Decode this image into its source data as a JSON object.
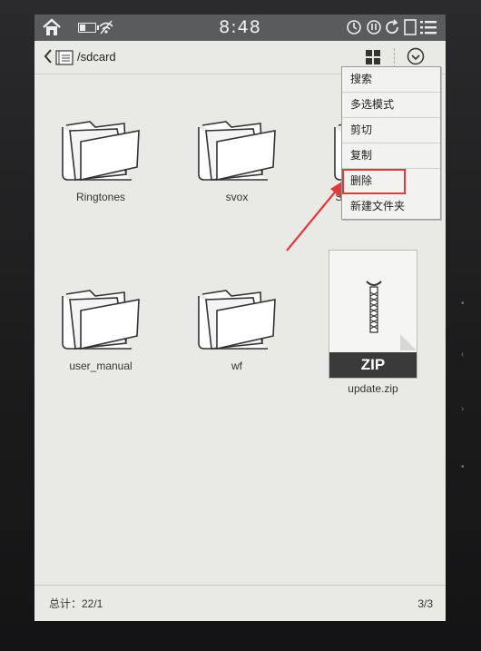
{
  "status_bar": {
    "time": "8:48",
    "battery_level": 0.3,
    "icons": [
      "home-icon",
      "battery-icon",
      "wifi-off-icon",
      "sync-icon",
      "power-icon",
      "refresh-icon",
      "tablet-icon",
      "menu-icon"
    ]
  },
  "toolbar": {
    "path": "/sdcard",
    "icons": [
      "back-icon",
      "folder-icon",
      "grid-view-icon",
      "check-circle-icon"
    ]
  },
  "items": [
    {
      "name": "Ringtones",
      "type": "folder"
    },
    {
      "name": "svox",
      "type": "folder"
    },
    {
      "name": "System Volume Information",
      "type": "folder"
    },
    {
      "name": "user_manual",
      "type": "folder"
    },
    {
      "name": "wf",
      "type": "folder"
    },
    {
      "name": "update.zip",
      "type": "zip",
      "badge": "ZIP"
    }
  ],
  "context_menu": {
    "items": [
      "搜索",
      "多选模式",
      "剪切",
      "复制",
      "删除",
      "新建文件夹"
    ],
    "highlighted": "删除",
    "highlight_color": "#e03a3a"
  },
  "footer": {
    "total": "总计：22/1",
    "page": "3/3"
  }
}
